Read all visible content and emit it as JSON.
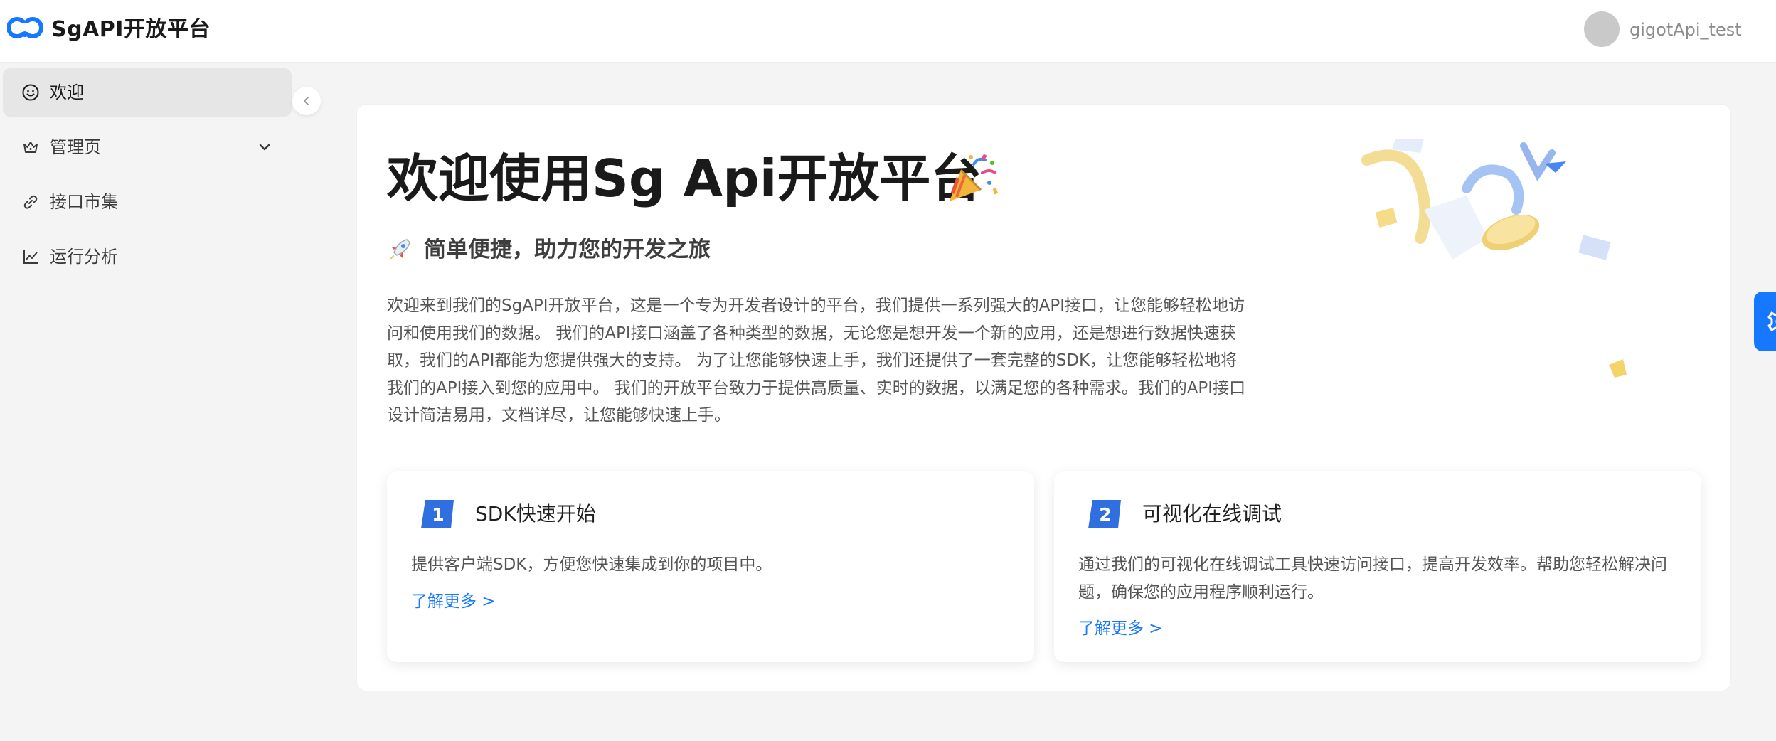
{
  "header": {
    "brand": "SgAPI开放平台",
    "username": "gigotApi_test"
  },
  "sidebar": {
    "items": [
      {
        "label": "欢迎",
        "icon": "smile-icon",
        "active": true
      },
      {
        "label": "管理页",
        "icon": "crown-icon",
        "has_submenu": true
      },
      {
        "label": "接口市集",
        "icon": "link-icon"
      },
      {
        "label": "运行分析",
        "icon": "line-chart-icon"
      }
    ]
  },
  "main": {
    "title": "欢迎使用Sg Api开放平台",
    "title_emoji": "party-popper-icon",
    "subtitle": "简单便捷，助力您的开发之旅",
    "subtitle_icon": "rocket-icon",
    "description": "欢迎来到我们的SgAPI开放平台，这是一个专为开发者设计的平台，我们提供一系列强大的API接口，让您能够轻松地访问和使用我们的数据。 我们的API接口涵盖了各种类型的数据，无论您是想开发一个新的应用，还是想进行数据快速获取，我们的API都能为您提供强大的支持。 为了让您能够快速上手，我们还提供了一套完整的SDK，让您能够轻松地将我们的API接入到您的应用中。 我们的开放平台致力于提供高质量、实时的数据，以满足您的各种需求。我们的API接口设计简洁易用，文档详尽，让您能够快速上手。",
    "features": [
      {
        "number": "1",
        "title": "SDK快速开始",
        "description": "提供客户端SDK，方便您快速集成到你的项目中。",
        "link": "了解更多 >"
      },
      {
        "number": "2",
        "title": "可视化在线调试",
        "description": "通过我们的可视化在线调试工具快速访问接口，提高开发效率。帮助您轻松解决问题，确保您的应用程序顺利运行。",
        "link": "了解更多 >"
      }
    ]
  },
  "floating": {
    "settings_icon": "gear-icon"
  },
  "colors": {
    "accent": "#1677ff",
    "badge": "#2f6fe0",
    "sidebar_active": "#e6e6e6",
    "background": "#f4f4f4"
  }
}
